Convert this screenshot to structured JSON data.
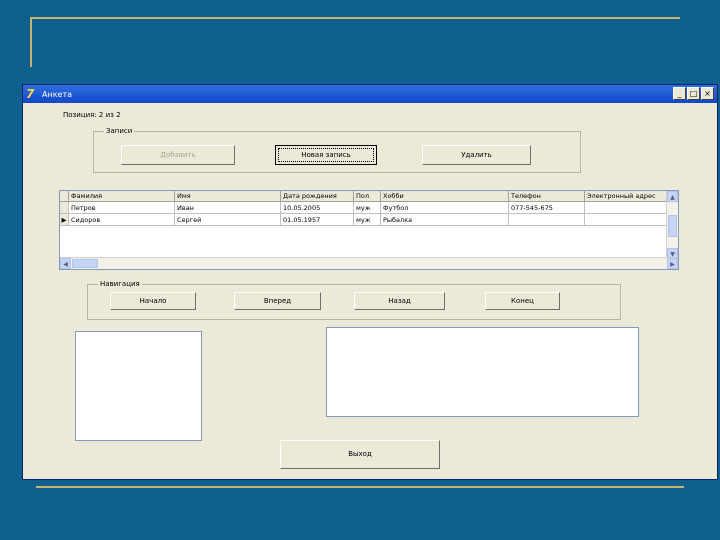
{
  "window": {
    "title": "Анкета",
    "minimize_glyph": "_",
    "maximize_glyph": "□",
    "close_glyph": "×",
    "app_icon_glyph": "7",
    "icon": "delphi-app-icon"
  },
  "position_label": "Позиция: 2 из 2",
  "records_group": {
    "title": "Записи",
    "buttons": [
      "Добавить",
      "Новая запись",
      "Удалить"
    ]
  },
  "grid": {
    "columns": [
      "Фамилия",
      "Имя",
      "Дата рождения",
      "Пол",
      "Хобби",
      "Телефон",
      "Электронный адрес"
    ],
    "rows": [
      {
        "indicator": "",
        "cells": [
          "Петров",
          "Иван",
          "10.05.2005",
          "муж",
          "Футбол",
          "077-545-675",
          ""
        ]
      },
      {
        "indicator": "▶",
        "cells": [
          "Сидоров",
          "Сергей",
          "01.05.1957",
          "муж",
          "Рыбалка",
          "",
          ""
        ]
      }
    ],
    "scroll_up": "▲",
    "scroll_down": "▼",
    "scroll_left": "◀",
    "scroll_right": "▶"
  },
  "navigation_group": {
    "title": "Навигация",
    "buttons": [
      "Начало",
      "Вперед",
      "Назад",
      "Конец"
    ]
  },
  "exit_button": "Выход"
}
